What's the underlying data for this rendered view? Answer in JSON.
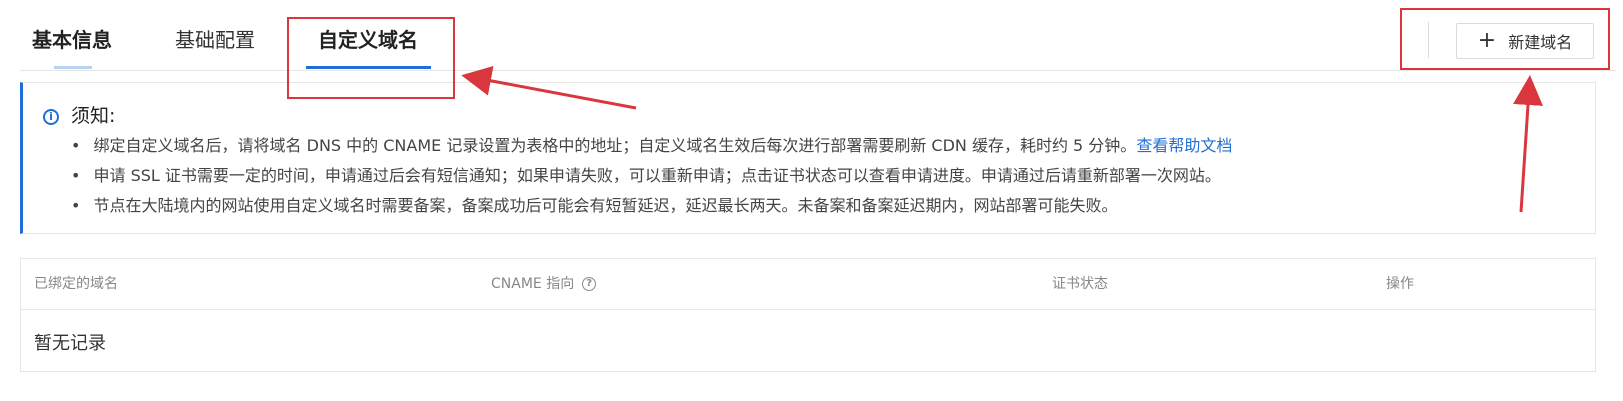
{
  "tabs": [
    {
      "label": "基本信息",
      "active": false
    },
    {
      "label": "基础配置",
      "active": false
    },
    {
      "label": "自定义域名",
      "active": true
    }
  ],
  "actions": {
    "new_domain_label": "新建域名",
    "plus_icon": "plus-icon"
  },
  "notice": {
    "title": "须知:",
    "items": [
      "绑定自定义域名后，请将域名 DNS 中的 CNAME 记录设置为表格中的地址；自定义域名生效后每次进行部署需要刷新 CDN 缓存，耗时约 5 分钟。",
      "申请 SSL 证书需要一定的时间，申请通过后会有短信通知；如果申请失败，可以重新申请；点击证书状态可以查看申请进度。申请通过后请重新部署一次网站。",
      "节点在大陆境内的网站使用自定义域名时需要备案，备案成功后可能会有短暂延迟，延迟最长两天。未备案和备案延迟期内，网站部署可能失败。"
    ],
    "help_link": "查看帮助文档",
    "icon": "info-icon"
  },
  "table": {
    "columns": [
      "已绑定的域名",
      "CNAME 指向",
      "证书状态",
      "操作"
    ],
    "empty_text": "暂无记录"
  },
  "colors": {
    "accent": "#1f6fd6",
    "annotation": "#d9363e"
  }
}
